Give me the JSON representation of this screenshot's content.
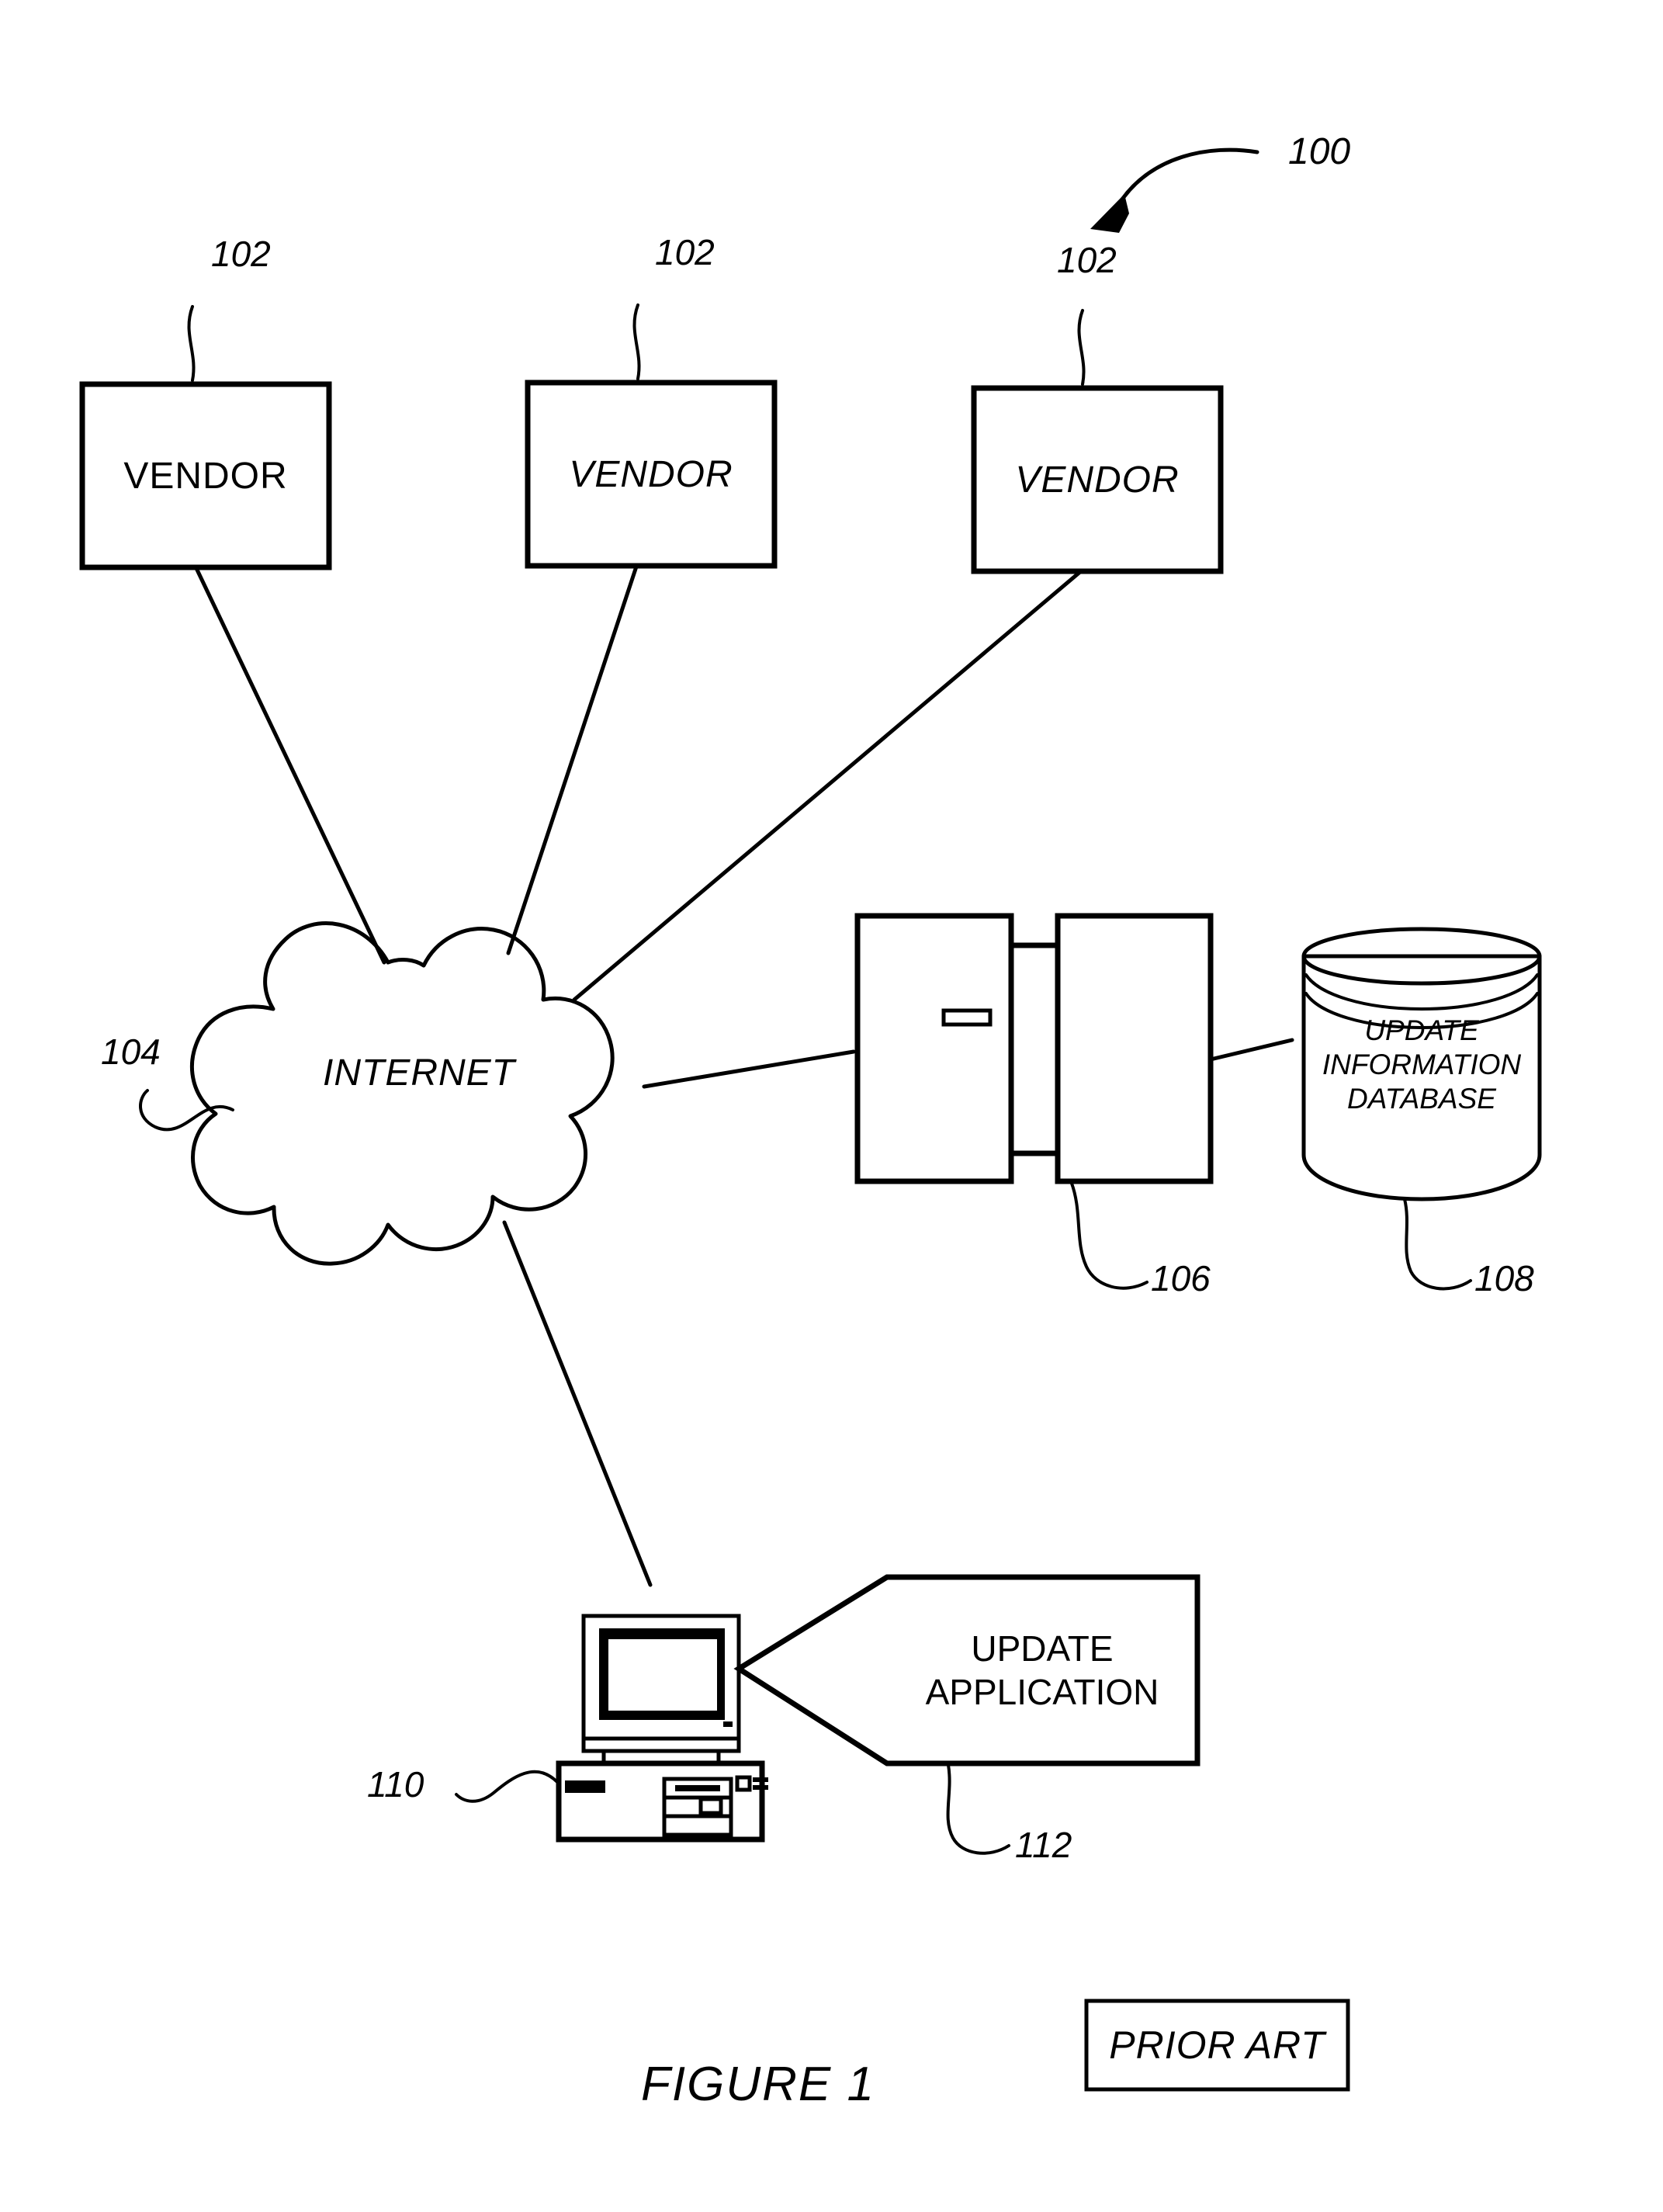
{
  "figure": {
    "caption": "FIGURE 1",
    "prior_art_label": "PRIOR ART",
    "system_ref": "100"
  },
  "nodes": {
    "vendor_1": {
      "label": "VENDOR",
      "ref": "102"
    },
    "vendor_2": {
      "label": "VENDOR",
      "ref": "102"
    },
    "vendor_3": {
      "label": "VENDOR",
      "ref": "102"
    },
    "network": {
      "label": "INTERNET",
      "ref": "104"
    },
    "server": {
      "label": "",
      "ref": "106"
    },
    "database": {
      "line1": "UPDATE",
      "line2": "INFORMATION",
      "line3": "DATABASE",
      "ref": "108"
    },
    "client": {
      "label": "",
      "ref": "110"
    },
    "callout": {
      "line1": "UPDATE",
      "line2": "APPLICATION",
      "ref": "112"
    }
  },
  "colors": {
    "ink": "#000000",
    "paper": "#ffffff"
  }
}
